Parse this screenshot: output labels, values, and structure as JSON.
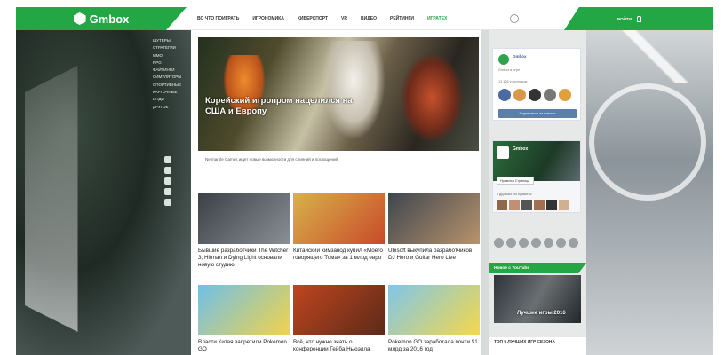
{
  "header": {
    "logo_text": "Gmbox",
    "nav": [
      "Во что поиграть",
      "Игрономика",
      "Киберспорт",
      "VR",
      "Видео",
      "Рейтинги",
      "Игратех"
    ],
    "active_nav_index": 6,
    "login_label": "Войти",
    "brand_color": "#22a744"
  },
  "categories": [
    "Шутеры",
    "Стратегии",
    "MMO",
    "RPG",
    "Файтинги",
    "Симуляторы",
    "Спортивные",
    "Карточные",
    "Инди",
    "Другое"
  ],
  "hero": {
    "title": "Корейский игропром нацелился на США и Европу",
    "caption": "Netmarble Games ищет новые возможности для слияний и поглощений"
  },
  "cards": [
    {
      "text": "Бывшие разработчики The Witcher 3, Hitman и Dying Light основали новую студию",
      "color1": "#3b4148",
      "color2": "#8a8f94"
    },
    {
      "text": "Китайский химзавод купил «Моего говорящего Тома» за 1 млрд евро",
      "color1": "#d8b24a",
      "color2": "#c94a2a"
    },
    {
      "text": "Ubisoft выкупила разработчиков DJ Hero и Guitar Hero Live",
      "color1": "#3f4650",
      "color2": "#b8936b"
    },
    {
      "text": "Власти Китая запретили Pokemon GO",
      "color1": "#6fc0e8",
      "color2": "#f2d34a"
    },
    {
      "text": "Всё, что нужно знать о конференции Гейба Ньюэлла",
      "color1": "#c0451f",
      "color2": "#5b2a18"
    },
    {
      "text": "Pokemon GO заработала почти $1 млрд за 2016 год",
      "color1": "#7fc6ea",
      "color2": "#f5d84a"
    }
  ],
  "vk": {
    "name": "Gmbox",
    "sub": "Gmbox в игре",
    "members": "13 126 участников",
    "button": "Подписаться на новости",
    "face_colors": [
      "#4a6aa0",
      "#d89a4a",
      "#333",
      "#777",
      "#e0a040"
    ]
  },
  "fb": {
    "name": "Gmbox",
    "like_label": "Нравится Страница",
    "friends_text": "3 друзьям это нравится"
  },
  "youtube": {
    "header": "Новое с YouTube",
    "video_title": "Лучшие игры 2016"
  },
  "top5": {
    "label": "Топ 5 лучших игр сезона"
  }
}
